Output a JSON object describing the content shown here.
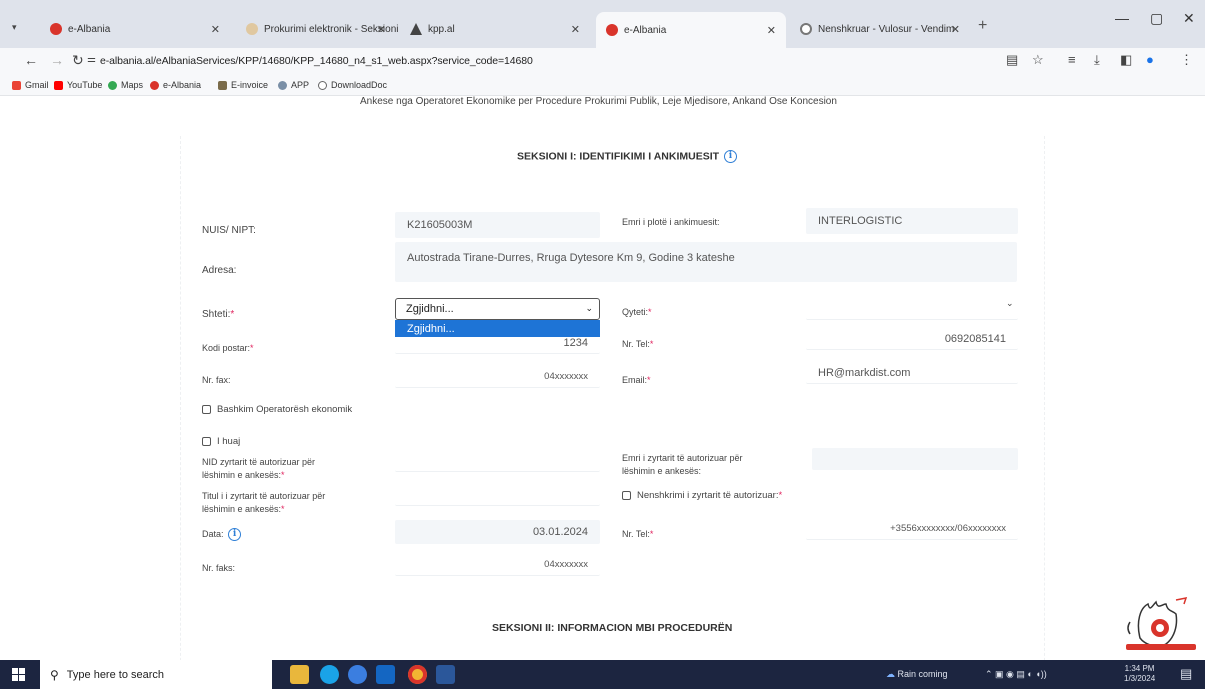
{
  "browser": {
    "tabs": [
      {
        "label": "e-Albania",
        "favicon": "e-albania-icon",
        "color": "#d9342b"
      },
      {
        "label": "Prokurimi elektronik - Seksioni",
        "favicon": "procurement-icon",
        "color": "#e0c8a0"
      },
      {
        "label": "kpp.al",
        "favicon": "drive-icon",
        "color": "#444444"
      },
      {
        "label": "e-Albania",
        "favicon": "e-albania-icon",
        "color": "#d9342b"
      },
      {
        "label": "Nenshkruar - Vulosur - Vendim",
        "favicon": "chrome-icon",
        "color": "#777777"
      }
    ],
    "url": "e-albania.al/eAlbaniaServices/KPP/14680/KPP_14680_n4_s1_web.aspx?service_code=14680",
    "bookmarks": [
      {
        "label": "Gmail",
        "color": "#ea4335"
      },
      {
        "label": "YouTube",
        "color": "#ff0000"
      },
      {
        "label": "Maps",
        "color": "#34a853"
      },
      {
        "label": "e-Albania",
        "color": "#d9342b"
      },
      {
        "label": "E-invoice",
        "color": "#7a6b4a"
      },
      {
        "label": "APP",
        "color": "#7a8fa6"
      },
      {
        "label": "DownloadDoc",
        "color": "#666666"
      }
    ]
  },
  "page": {
    "cut_heading": "Ankese nga Operatoret Ekonomike per Procedure Prokurimi Publik, Leje Mjedisore, Ankand Ose Koncesion",
    "section1_title": "SEKSIONI I: IDENTIFIKIMI I ANKIMUESIT",
    "section2_title": "SEKSIONI II: INFORMACION MBI PROCEDURËN",
    "labels": {
      "nipt": "NUIS/ NIPT:",
      "full_name": "Emri i plotë i ankimuesit:",
      "address": "Adresa:",
      "country": "Shteti:",
      "city": "Qyteti:",
      "postal": "Kodi postar:",
      "tel": "Nr. Tel:",
      "fax": "Nr. fax:",
      "email": "Email:",
      "joint": "Bashkim Operatorësh ekonomik",
      "foreign": "I huaj",
      "nid_line1": "NID  zyrtarit të autorizuar për",
      "nid_line2": "lëshimin e ankesës:",
      "official_name_line1": "Emri i zyrtarit të autorizuar për",
      "official_name_line2": "lëshimin e ankesës:",
      "title_line1": "Titul i i zyrtarit të autorizuar për",
      "title_line2": "lëshimin e ankesës:",
      "signature": "Nenshkrimi i zyrtarit të autorizuar:",
      "date": "Data:",
      "tel2": "Nr. Tel:",
      "fax2": "Nr. faks:"
    },
    "values": {
      "nipt": "K21605003M",
      "full_name": "INTERLOGISTIC",
      "address": "Autostrada Tirane-Durres, Rruga Dytesore Km 9, Godine 3 kateshe",
      "country_selected": "Zgjidhni...",
      "country_option": "Zgjidhni...",
      "postal": "1234",
      "tel": "0692085141",
      "fax": "04xxxxxxx",
      "email": "HR@markdist.com",
      "date": "03.01.2024",
      "tel2": "+3556xxxxxxxx/06xxxxxxxx",
      "fax2": "04xxxxxxx"
    }
  },
  "taskbar": {
    "search_placeholder": "Type here to search",
    "weather": "Rain coming",
    "time": "1:34 PM",
    "date": "1/3/2024"
  }
}
